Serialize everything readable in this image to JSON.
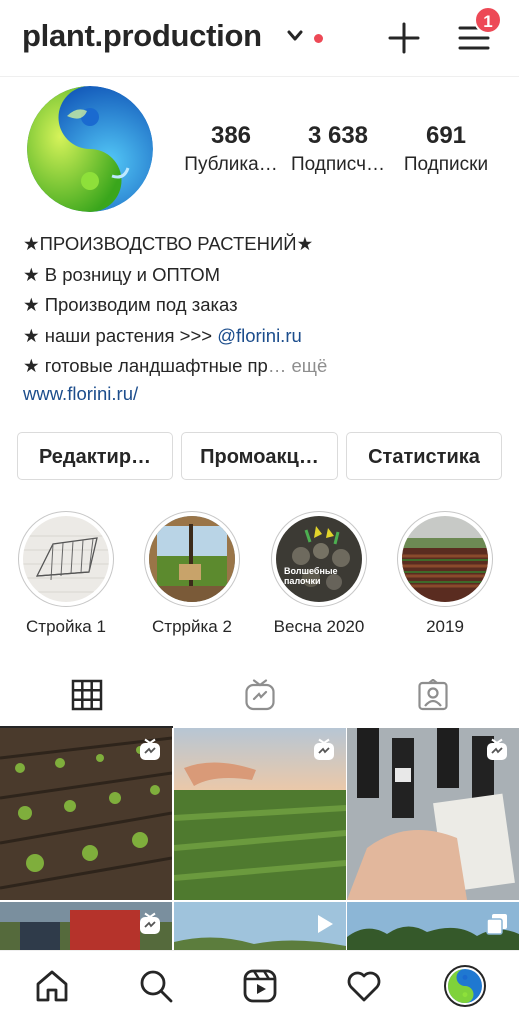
{
  "header": {
    "username": "plant.production",
    "notification_count": "1",
    "accent": "#ed4956"
  },
  "stats": [
    {
      "value": "386",
      "label": "Публика…"
    },
    {
      "value": "3 638",
      "label": "Подписч…"
    },
    {
      "value": "691",
      "label": "Подписки"
    }
  ],
  "bio": {
    "name": "★ПРОИЗВОДСТВО РАСТЕНИЙ★",
    "line1": "★ В розницу и ОПТОМ",
    "line2": "★ Производим под заказ",
    "line3_prefix": "★ наши растения >>> ",
    "line3_mention": "@florini.ru",
    "line4": "★ готовые ландшафтные пр",
    "line4_more": "… ещё",
    "website": "www.florini.ru/"
  },
  "buttons": {
    "edit": "Редактир…",
    "promo": "Промоакц…",
    "stats": "Статистика"
  },
  "highlights": [
    {
      "label": "Стройка 1"
    },
    {
      "label": "Стррйка 2"
    },
    {
      "label": "Весна 2020",
      "overlay_text": "Волшебные палочки"
    },
    {
      "label": "2019"
    }
  ],
  "tabs": [
    {
      "icon": "grid-icon",
      "active": true
    },
    {
      "icon": "igtv-icon",
      "active": false
    },
    {
      "icon": "tagged-icon",
      "active": false
    }
  ],
  "posts": [
    {
      "type": "igtv",
      "subject": "field rows with seedlings"
    },
    {
      "type": "igtv",
      "subject": "hand over green field at sunset"
    },
    {
      "type": "igtv",
      "subject": "bottles and boxes"
    },
    {
      "type": "igtv",
      "subject": "red tractor"
    },
    {
      "type": "reel",
      "subject": "sky and trees"
    },
    {
      "type": "carousel",
      "subject": "trees under sky"
    }
  ],
  "bottom_nav": [
    "home-icon",
    "search-icon",
    "reels-icon",
    "heart-icon",
    "profile-avatar"
  ]
}
